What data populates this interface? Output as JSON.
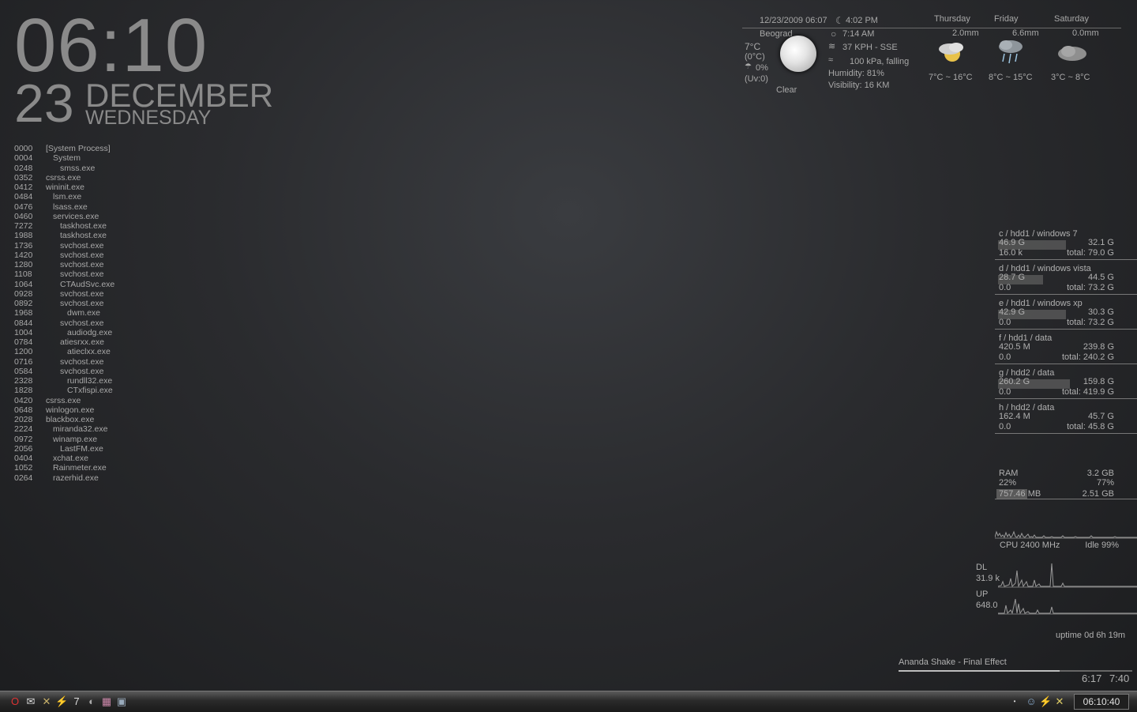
{
  "clock": {
    "time": "06:10",
    "day": "23",
    "month": "DECEMBER",
    "weekday": "WEDNESDAY"
  },
  "processes": [
    {
      "pid": "0000",
      "name": "[System Process]",
      "indent": 0
    },
    {
      "pid": "0004",
      "name": "System",
      "indent": 1
    },
    {
      "pid": "0248",
      "name": "smss.exe",
      "indent": 2
    },
    {
      "pid": "0352",
      "name": "csrss.exe",
      "indent": 0
    },
    {
      "pid": "0412",
      "name": "wininit.exe",
      "indent": 0
    },
    {
      "pid": "0484",
      "name": "lsm.exe",
      "indent": 1
    },
    {
      "pid": "0476",
      "name": "lsass.exe",
      "indent": 1
    },
    {
      "pid": "0460",
      "name": "services.exe",
      "indent": 1
    },
    {
      "pid": "7272",
      "name": "taskhost.exe",
      "indent": 2
    },
    {
      "pid": "1988",
      "name": "taskhost.exe",
      "indent": 2
    },
    {
      "pid": "1736",
      "name": "svchost.exe",
      "indent": 2
    },
    {
      "pid": "1420",
      "name": "svchost.exe",
      "indent": 2
    },
    {
      "pid": "1280",
      "name": "svchost.exe",
      "indent": 2
    },
    {
      "pid": "1108",
      "name": "svchost.exe",
      "indent": 2
    },
    {
      "pid": "1064",
      "name": "CTAudSvc.exe",
      "indent": 2
    },
    {
      "pid": "0928",
      "name": "svchost.exe",
      "indent": 2
    },
    {
      "pid": "0892",
      "name": "svchost.exe",
      "indent": 2
    },
    {
      "pid": "1968",
      "name": "dwm.exe",
      "indent": 3
    },
    {
      "pid": "0844",
      "name": "svchost.exe",
      "indent": 2
    },
    {
      "pid": "1004",
      "name": "audiodg.exe",
      "indent": 3
    },
    {
      "pid": "0784",
      "name": "atiesrxx.exe",
      "indent": 2
    },
    {
      "pid": "1200",
      "name": "atieclxx.exe",
      "indent": 3
    },
    {
      "pid": "0716",
      "name": "svchost.exe",
      "indent": 2
    },
    {
      "pid": "0584",
      "name": "svchost.exe",
      "indent": 2
    },
    {
      "pid": "2328",
      "name": "rundll32.exe",
      "indent": 3
    },
    {
      "pid": "1828",
      "name": "CTxfispi.exe",
      "indent": 3
    },
    {
      "pid": "0420",
      "name": "csrss.exe",
      "indent": 0
    },
    {
      "pid": "0648",
      "name": "winlogon.exe",
      "indent": 0
    },
    {
      "pid": "2028",
      "name": "blackbox.exe",
      "indent": 0
    },
    {
      "pid": "2224",
      "name": "miranda32.exe",
      "indent": 1
    },
    {
      "pid": "0972",
      "name": "winamp.exe",
      "indent": 1
    },
    {
      "pid": "2056",
      "name": "LastFM.exe",
      "indent": 2
    },
    {
      "pid": "0404",
      "name": "xchat.exe",
      "indent": 1
    },
    {
      "pid": "1052",
      "name": "Rainmeter.exe",
      "indent": 1
    },
    {
      "pid": "0264",
      "name": "razerhid.exe",
      "indent": 1
    }
  ],
  "weather": {
    "updated": "12/23/2009 06:07",
    "sunset": "4:02 PM",
    "city": "Beograd",
    "sunrise": "7:14 AM",
    "temp": "7°C",
    "feels": "(0°C)",
    "precip": "0%",
    "uv": "(Uv:0)",
    "wind": "37 KPH - SSE",
    "pressure": "100 kPa, falling",
    "humidity": "Humidity: 81%",
    "visibility": "Visibility: 16 KM",
    "condition": "Clear",
    "forecast": [
      {
        "day": "Thursday",
        "rain": "2.0mm",
        "range": "7°C ~ 16°C",
        "icon": "sun-cloud-icon"
      },
      {
        "day": "Friday",
        "rain": "6.6mm",
        "range": "8°C ~ 15°C",
        "icon": "rain-cloud-icon"
      },
      {
        "day": "Saturday",
        "rain": "0.0mm",
        "range": "3°C ~ 8°C",
        "icon": "cloud-icon"
      }
    ]
  },
  "drives": [
    {
      "title": "c / hdd1 / windows 7",
      "used": "46.9 G",
      "free": "32.1 G",
      "rate": "16.0 k",
      "total": "total: 79.0 G",
      "used_fraction": 0.59
    },
    {
      "title": "d / hdd1 / windows vista",
      "used": "28.7 G",
      "free": "44.5 G",
      "rate": "0.0",
      "total": "total: 73.2 G",
      "used_fraction": 0.39
    },
    {
      "title": "e / hdd1 / windows xp",
      "used": "42.9 G",
      "free": "30.3 G",
      "rate": "0.0",
      "total": "total: 73.2 G",
      "used_fraction": 0.59
    },
    {
      "title": "f / hdd1 / data",
      "used": "420.5 M",
      "free": "239.8 G",
      "rate": "0.0",
      "total": "total: 240.2 G",
      "used_fraction": 0.0
    },
    {
      "title": "g / hdd2 / data",
      "used": "260.2 G",
      "free": "159.8 G",
      "rate": "0.0",
      "total": "total: 419.9 G",
      "used_fraction": 0.62
    },
    {
      "title": "h / hdd2 / data",
      "used": "162.4 M",
      "free": "45.7 G",
      "rate": "0.0",
      "total": "total: 45.8 G",
      "used_fraction": 0.0
    }
  ],
  "ram": {
    "label": "RAM",
    "total": "3.2 GB",
    "used_pct": "22%",
    "free_pct": "77%",
    "used": "757.46 MB",
    "free": "2.51 GB",
    "used_fraction": 0.22
  },
  "cpu": {
    "label": "CPU 2400 MHz",
    "idle": "Idle 99%"
  },
  "net": {
    "dl_label": "DL",
    "dl_value": "31.9 k",
    "up_label": "UP",
    "up_value": "648.0"
  },
  "uptime": "uptime 0d 6h 19m",
  "music": {
    "track": "Ananda Shake - Final Effect",
    "elapsed": "6:17",
    "length": "7:40",
    "progress": 0.69
  },
  "taskbar": {
    "clock": "06:10:40",
    "left_icons": [
      "opera-icon",
      "mail-icon",
      "tools-icon",
      "winamp-icon",
      "lastfm-icon",
      "globe-icon",
      "grid-icon",
      "save-icon"
    ],
    "tray_icons": [
      "dot-icon",
      "messenger-icon",
      "winamp-tray-icon",
      "xchat-icon"
    ]
  }
}
